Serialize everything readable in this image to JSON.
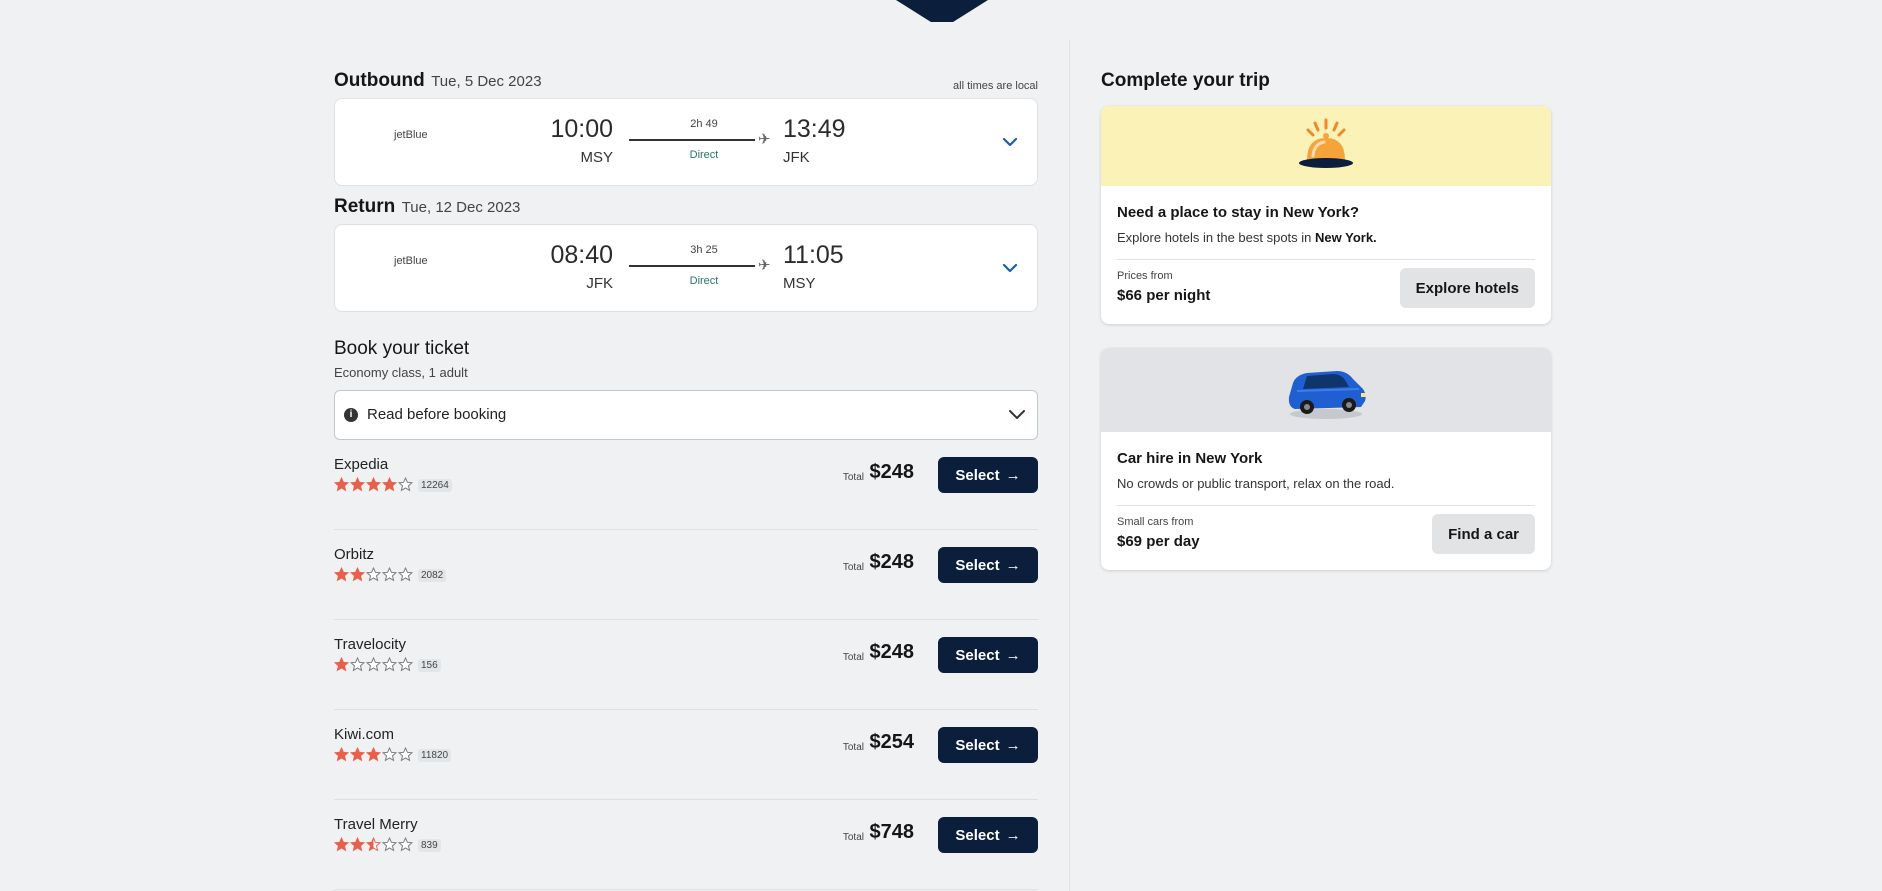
{
  "outbound": {
    "title": "Outbound",
    "date": "Tue, 5 Dec 2023",
    "note": "all times are local",
    "airline": "jetBlue",
    "dep_time": "10:00",
    "dep_code": "MSY",
    "arr_time": "13:49",
    "arr_code": "JFK",
    "duration": "2h 49",
    "stops": "Direct"
  },
  "return": {
    "title": "Return",
    "date": "Tue, 12 Dec 2023",
    "airline": "jetBlue",
    "dep_time": "08:40",
    "dep_code": "JFK",
    "arr_time": "11:05",
    "arr_code": "MSY",
    "duration": "3h 25",
    "stops": "Direct"
  },
  "booking": {
    "title": "Book your ticket",
    "subtitle": "Economy class, 1 adult",
    "read_before": "Read before booking",
    "total_label": "Total",
    "select_label": "Select",
    "providers": [
      {
        "name": "Expedia",
        "rating": 4,
        "reviews": "12264",
        "price": "$248"
      },
      {
        "name": "Orbitz",
        "rating": 2,
        "reviews": "2082",
        "price": "$248"
      },
      {
        "name": "Travelocity",
        "rating": 1,
        "reviews": "156",
        "price": "$248"
      },
      {
        "name": "Kiwi.com",
        "rating": 3,
        "reviews": "11820",
        "price": "$254"
      },
      {
        "name": "Travel Merry",
        "rating": 2.5,
        "reviews": "839",
        "price": "$748"
      }
    ]
  },
  "complete_trip": {
    "title": "Complete your trip",
    "hotel": {
      "heading": "Need a place to stay in New York?",
      "text": "Explore hotels in the best spots in",
      "text_bold": "New York.",
      "from_label": "Prices from",
      "amount": "$66 per night",
      "button": "Explore hotels",
      "icon": "bell-icon"
    },
    "car": {
      "heading": "Car hire in New York",
      "text": "No crowds or public transport, relax on the road.",
      "from_label": "Small cars from",
      "amount": "$69 per day",
      "button": "Find a car",
      "icon": "car-icon"
    }
  },
  "colors": {
    "navy": "#0b1e3c",
    "star": "#e8604c",
    "hotel_banner": "#fbf2b8",
    "car_banner": "#e1e3e6",
    "direct": "#25766a"
  }
}
